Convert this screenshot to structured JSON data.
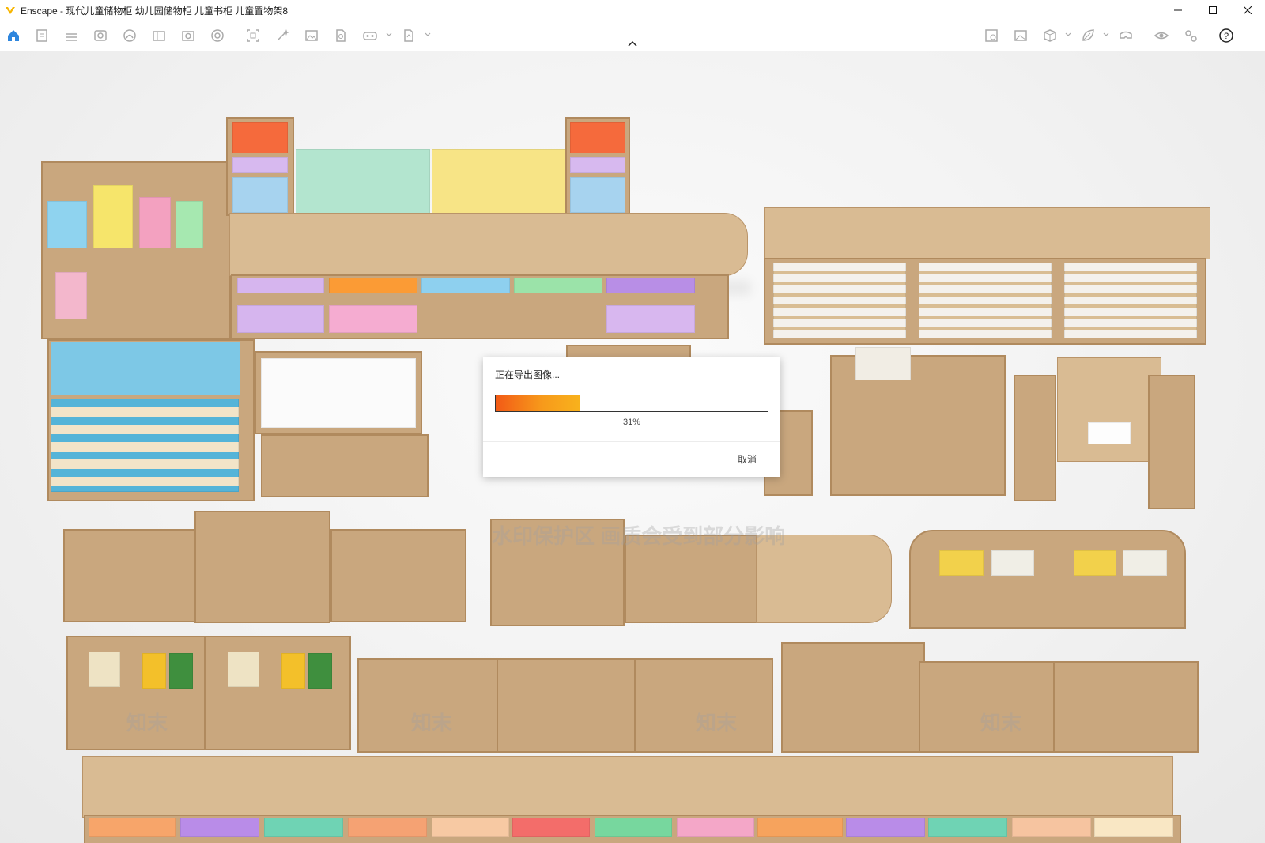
{
  "window": {
    "title": "Enscape - 现代儿童储物柜 幼儿园储物柜 儿童书柜 儿童置物架8",
    "controls": [
      "minimize",
      "maximize",
      "close"
    ]
  },
  "toolbar": {
    "left_icons": [
      "home-icon",
      "document-icon",
      "bim-icon",
      "view-icon",
      "asset-icon",
      "library-icon",
      "capture-icon",
      "panorama-icon",
      "batch-icon",
      "magic-icon",
      "image-icon",
      "export-file-icon",
      "vr-icon",
      "upload-icon"
    ],
    "right_icons": [
      "gallery-icon",
      "render-icon",
      "box-icon",
      "leaf-icon",
      "vr-headset-icon",
      "eye-icon",
      "settings-icon",
      "help-icon"
    ],
    "accent_color": "#2e86de"
  },
  "watermark": {
    "notice": "水印保护区 画质会受到部分影响",
    "brand": "知末"
  },
  "dialog": {
    "title": "正在导出图像...",
    "progress": 0.31,
    "percent_text": "31%",
    "cancel_label": "取消"
  },
  "colors": {
    "wood": "#c9a77e",
    "progress_start": "#f25a16",
    "progress_end": "#f8b21c"
  }
}
